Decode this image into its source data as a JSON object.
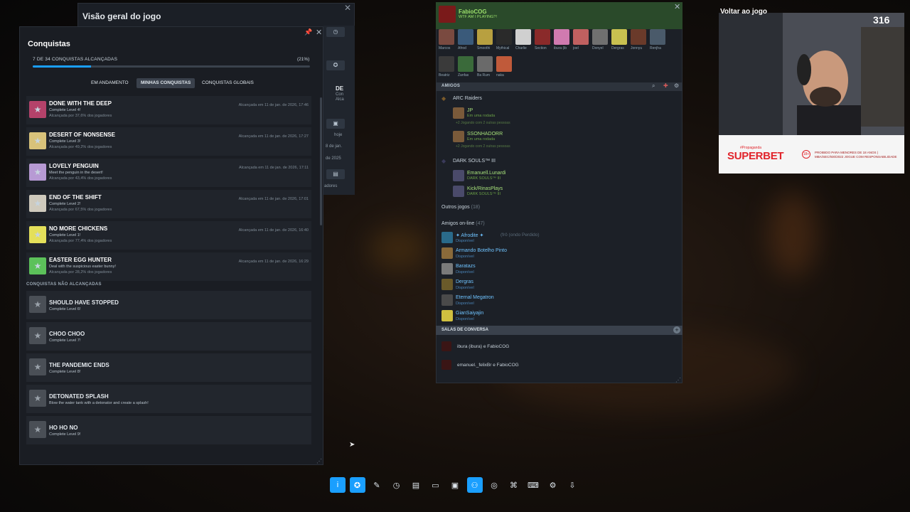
{
  "overlay": {
    "back_to_game": "Voltar ao jogo",
    "viewer_count": "316"
  },
  "overview": {
    "title": "Visão geral do jogo",
    "side_texts": [
      "DE",
      "Con",
      "Alca",
      "hoje",
      "8 de jan.",
      "de 2025",
      "adores"
    ]
  },
  "achievements": {
    "title": "Conquistas",
    "progress_text": "7 DE 34 CONQUISTAS ALCANÇADAS",
    "progress_pct": "(21%)",
    "progress_fraction": 0.21,
    "tabs": [
      {
        "label": "EM ANDAMENTO",
        "active": false
      },
      {
        "label": "MINHAS CONQUISTAS",
        "active": true
      },
      {
        "label": "CONQUISTAS GLOBAIS",
        "active": false
      }
    ],
    "unlocked": [
      {
        "name": "DONE WITH THE DEEP",
        "desc": "Complete Level 4!",
        "rate": "Alcançada por 37,6% dos jogadores",
        "date": "Alcançada em 11 de jan. de 2026, 17:46",
        "icon": "achievement-deep-icon",
        "color": "#b4426a"
      },
      {
        "name": "DESERT OF NONSENSE",
        "desc": "Complete Level 3!",
        "rate": "Alcançada por 49,2% dos jogadores",
        "date": "Alcançada em 11 de jan. de 2026, 17:27",
        "icon": "achievement-desert-icon",
        "color": "#d8c27a"
      },
      {
        "name": "LOVELY PENGUIN",
        "desc": "Meet the penguin in the desert!",
        "rate": "Alcançada por 43,4% dos jogadores",
        "date": "Alcançada em 11 de jan. de 2026, 17:11",
        "icon": "achievement-penguin-icon",
        "color": "#b79ad4"
      },
      {
        "name": "END OF THE SHIFT",
        "desc": "Complete Level 2!",
        "rate": "Alcançada por 67,5% dos jogadores",
        "date": "Alcançada em 11 de jan. de 2026, 17:01",
        "icon": "achievement-shift-icon",
        "color": "#cfcabd"
      },
      {
        "name": "NO MORE CHICKENS",
        "desc": "Complete Level 1!",
        "rate": "Alcançada por 77,4% dos jogadores",
        "date": "Alcançada em 11 de jan. de 2026, 16:40",
        "icon": "achievement-chicken-icon",
        "color": "#e4e05a"
      },
      {
        "name": "EASTER EGG HUNTER",
        "desc": "Deal with the suspicious easter bunny!",
        "rate": "Alcançada por 28,2% dos jogadores",
        "date": "Alcançada em 11 de jan. de 2026, 16:29",
        "icon": "achievement-easter-icon",
        "color": "#5cc15a"
      }
    ],
    "locked_header": "CONQUISTAS NÃO ALCANÇADAS",
    "locked": [
      {
        "name": "SHOULD HAVE STOPPED",
        "desc": "Complete Level 6!",
        "icon": "achievement-stopped-icon"
      },
      {
        "name": "CHOO CHOO",
        "desc": "Complete Level 7!",
        "icon": "achievement-train-icon"
      },
      {
        "name": "THE PANDEMIC ENDS",
        "desc": "Complete Level 8!",
        "icon": "achievement-pandemic-icon"
      },
      {
        "name": "DETONATED SPLASH",
        "desc": "Blow the water tank with a detonator and create a splash!",
        "icon": "achievement-splash-icon"
      },
      {
        "name": "HO HO NO",
        "desc": "Complete Level 9!",
        "icon": "achievement-hohono-icon"
      }
    ]
  },
  "friends": {
    "user_name": "FabioCOG",
    "user_status": "WTF AM I PLAYING?!",
    "favorites": [
      "Marcos",
      "Afrod",
      "Smoothi",
      "Mythical",
      "Charlie",
      "Section",
      "ibura (ib",
      "joel",
      "Donyel",
      "Dergras",
      "Jonnyu",
      "Renjha",
      "Beatriz",
      "Zanfas",
      "Ba Rum",
      "naka"
    ],
    "amigos_label": "AMIGOS",
    "groups": [
      {
        "title": "ARC Raiders",
        "members": [
          {
            "name": "JP",
            "sub": "Em uma rodada",
            "extra": "+2   Jogando com 2 outras pessoas"
          },
          {
            "name": "SSONHADORR",
            "sub": "Em uma rodada",
            "extra": "+2   Jogando com 2 outras pessoas"
          }
        ]
      },
      {
        "title": "DARK SOULS™ III",
        "members": [
          {
            "name": "Emanuell.Lunardi",
            "sub": "DARK SOULS™ III",
            "extra": ""
          },
          {
            "name": "Kick/RinasPlays",
            "sub": "DARK SOULS™ III",
            "extra": ""
          }
        ]
      }
    ],
    "other_games": "Outros jogos",
    "other_games_count": "(18)",
    "online_label": "Amigos on-line",
    "online_count": "(47)",
    "online": [
      {
        "name": "✦ Afrodite ✦",
        "extra": "(frô (ondo Perdido)",
        "sub": "Disponível"
      },
      {
        "name": "Armando Botelho Pinto",
        "extra": "",
        "sub": "Disponível"
      },
      {
        "name": "Baratazs",
        "extra": "",
        "sub": "Disponível"
      },
      {
        "name": "Dergras",
        "extra": "",
        "sub": "Disponível"
      },
      {
        "name": "Eternal Megatron",
        "extra": "",
        "sub": "Disponível"
      },
      {
        "name": "GianSaiyajin",
        "extra": "",
        "sub": "Disponível"
      }
    ],
    "salas_label": "SALAS DE CONVERSA",
    "rooms": [
      "ibura (ibura) e FabioCOG",
      "emanuel._felixBr e FabioCOG"
    ]
  },
  "ad": {
    "brand": "SUPERBET",
    "tag": "#Propaganda",
    "age": "18+",
    "legal": "PROIBIDO PARA MENORES DE 18 ANOS | MBA/SEC/930/2022 JOGUE COM RESPONSABILIDADE"
  },
  "toolbar": [
    {
      "icon": "info-icon",
      "glyph": "i",
      "active": true
    },
    {
      "icon": "achievements-icon",
      "glyph": "✪",
      "active": true
    },
    {
      "icon": "pencil-icon",
      "glyph": "✎",
      "active": false
    },
    {
      "icon": "clock-icon",
      "glyph": "◷",
      "active": false
    },
    {
      "icon": "guide-icon",
      "glyph": "▤",
      "active": false
    },
    {
      "icon": "chat-icon",
      "glyph": "▭",
      "active": false
    },
    {
      "icon": "screenshot-icon",
      "glyph": "▣",
      "active": false
    },
    {
      "icon": "friends-icon",
      "glyph": "⚇",
      "active": true
    },
    {
      "icon": "browser-icon",
      "glyph": "◎",
      "active": false
    },
    {
      "icon": "controller-icon",
      "glyph": "⌘",
      "active": false
    },
    {
      "icon": "keyboard-icon",
      "glyph": "⌨",
      "active": false
    },
    {
      "icon": "settings-icon",
      "glyph": "⚙",
      "active": false
    },
    {
      "icon": "download-icon",
      "glyph": "⇩",
      "active": false
    }
  ],
  "colors": {
    "accent": "#1a9fff",
    "in_game": "#a6e07a",
    "online": "#6fc3ff"
  }
}
